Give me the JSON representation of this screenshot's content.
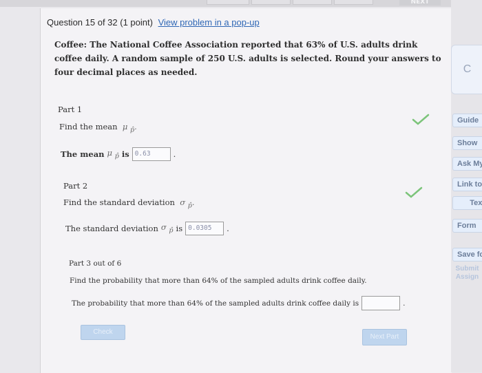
{
  "top": {
    "next_label": "NEXT"
  },
  "question": {
    "header": "Question 15 of 32 (1 point)",
    "popup_link": "View problem in a pop-up",
    "prompt": "Coffee: The National Coffee Association reported that 63% of U.S. adults drink coffee daily. A random sample of 250 U.S. adults is selected. Round your answers to four decimal places as needed."
  },
  "part1": {
    "title": "Part 1",
    "question": "Find the mean",
    "answer_prefix": "The mean",
    "answer_mid": "is",
    "value": "0.63",
    "status": "correct"
  },
  "part2": {
    "title": "Part 2",
    "question": "Find the standard deviation",
    "answer_prefix": "The standard deviation",
    "answer_mid": "is",
    "value": "0.0305",
    "status": "correct"
  },
  "part3": {
    "title": "Part 3 out of 6",
    "question": "Find the probability that more than 64% of the sampled adults drink coffee daily.",
    "answer_prefix": "The probability that more than 64% of the sampled adults drink coffee daily is",
    "value": ""
  },
  "buttons": {
    "check": "Check",
    "next": "Next Part"
  },
  "sidebar": {
    "guide": "Guide",
    "show": "Show",
    "ask": "Ask My",
    "link": "Link to",
    "text": "Text",
    "form": "Form",
    "save": "Save for",
    "submit": "Submit Assign",
    "c_label": "C"
  },
  "colors": {
    "check": "#7cc47a",
    "link": "#2f67b5",
    "button": "#bfd5ee"
  }
}
